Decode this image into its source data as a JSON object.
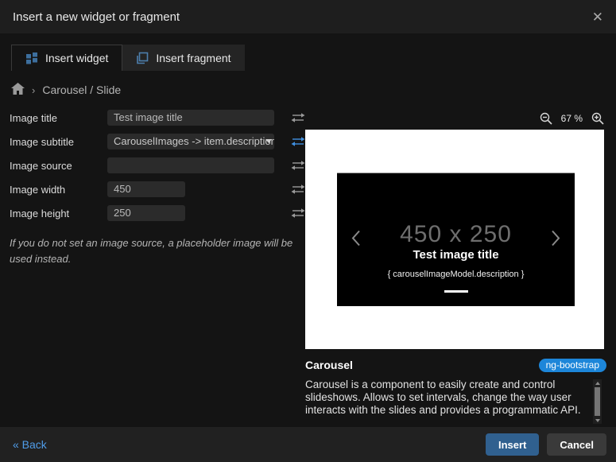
{
  "dialog": {
    "title": "Insert a new widget or fragment",
    "close_glyph": "✕"
  },
  "tabs": {
    "widget": {
      "label": "Insert widget",
      "icon": "widget-grid-icon",
      "active": true
    },
    "fragment": {
      "label": "Insert fragment",
      "icon": "fragment-copy-icon",
      "active": false
    }
  },
  "breadcrumb": {
    "separator": "›",
    "path": "Carousel / Slide"
  },
  "form": {
    "fields": [
      {
        "label": "Image title",
        "value": "Test image title",
        "type": "text"
      },
      {
        "label": "Image subtitle",
        "value": "CarouselImages -> item.description",
        "type": "select"
      },
      {
        "label": "Image source",
        "value": "",
        "type": "text"
      },
      {
        "label": "Image width",
        "value": "450",
        "type": "number"
      },
      {
        "label": "Image height",
        "value": "250",
        "type": "number"
      }
    ],
    "note": "If you do not set an image source, a placeholder image will be used instead."
  },
  "preview": {
    "zoom_level": "67 %",
    "carousel": {
      "placeholder": "450 x 250",
      "title": "Test image title",
      "subtitle": "{ carouselImageModel.description }"
    }
  },
  "widget_info": {
    "name": "Carousel",
    "badge": "ng-bootstrap",
    "description": "Carousel is a component to easily create and control slideshows. Allows to set intervals, change the way user interacts with the slides and provides a programmatic API."
  },
  "footer": {
    "back_label": "« Back",
    "insert_label": "Insert",
    "cancel_label": "Cancel"
  },
  "colors": {
    "accent_blue": "#3d6f9e",
    "badge_blue": "#1d86d9",
    "insert_button_blue": "#30608f",
    "link_blue": "#4f9ce8",
    "swap_active_blue": "#4090e0",
    "icon_gray": "#9a9a9a"
  }
}
